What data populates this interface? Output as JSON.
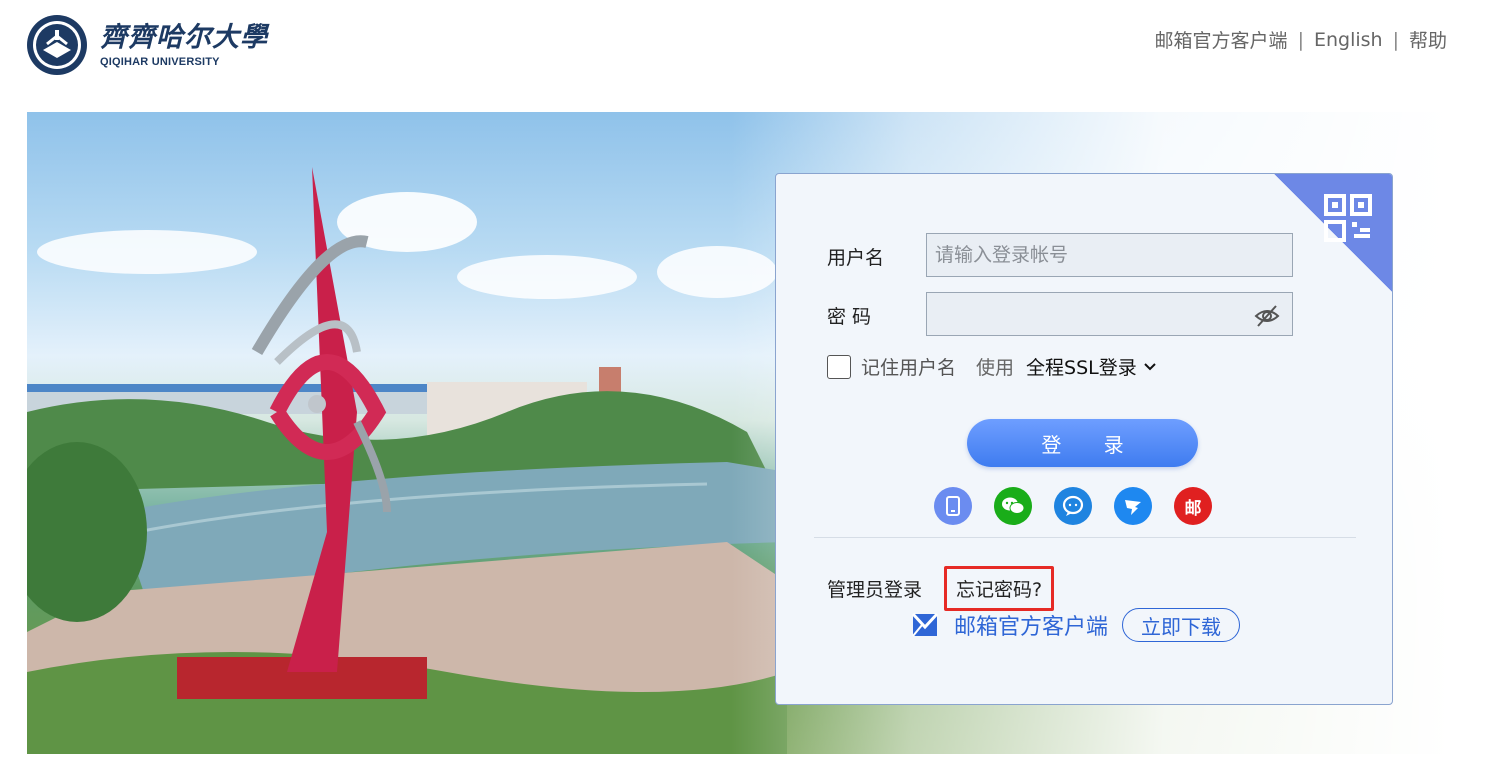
{
  "header": {
    "university_cn": "齊齊哈尔大學",
    "university_en": "QIQIHAR UNIVERSITY",
    "links": [
      "邮箱官方客户端",
      "English",
      "帮助"
    ],
    "separator": "|"
  },
  "login": {
    "username_label": "用户名",
    "username_placeholder": "请输入登录帐号",
    "password_label": "密 码",
    "remember_label": "记住用户名",
    "use_label": "使用",
    "ssl_option": "全程SSL登录",
    "submit_label": "登 录",
    "alt_icons": [
      "phone-icon",
      "wechat-icon",
      "qq-icon",
      "dingtalk-icon",
      "mail-icon"
    ],
    "mail_glyph": "邮",
    "admin_login": "管理员登录",
    "forgot_password": "忘记密码?",
    "client_name": "邮箱官方客户端",
    "download_label": "立即下载"
  },
  "colors": {
    "accent": "#3f7cf0",
    "highlight_box": "#e62a25",
    "qr_corner": "#6d88e6"
  }
}
